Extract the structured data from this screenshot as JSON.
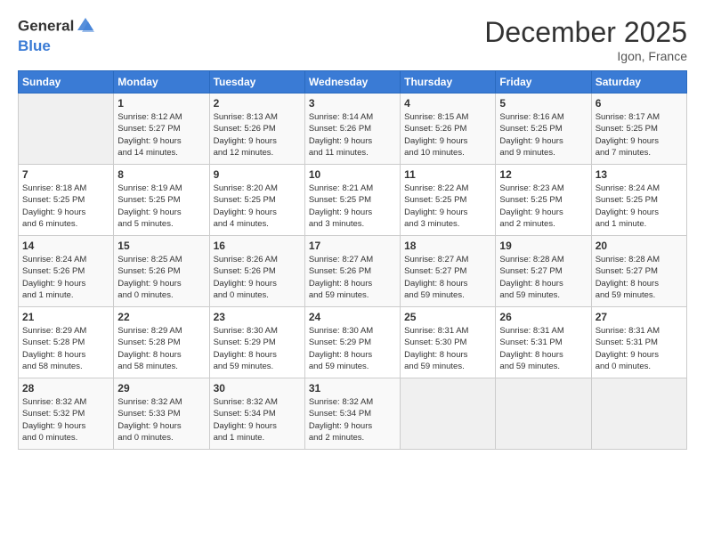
{
  "header": {
    "logo_general": "General",
    "logo_blue": "Blue",
    "title": "December 2025",
    "location": "Igon, France"
  },
  "days_of_week": [
    "Sunday",
    "Monday",
    "Tuesday",
    "Wednesday",
    "Thursday",
    "Friday",
    "Saturday"
  ],
  "weeks": [
    [
      {
        "day": "",
        "info": ""
      },
      {
        "day": "1",
        "info": "Sunrise: 8:12 AM\nSunset: 5:27 PM\nDaylight: 9 hours\nand 14 minutes."
      },
      {
        "day": "2",
        "info": "Sunrise: 8:13 AM\nSunset: 5:26 PM\nDaylight: 9 hours\nand 12 minutes."
      },
      {
        "day": "3",
        "info": "Sunrise: 8:14 AM\nSunset: 5:26 PM\nDaylight: 9 hours\nand 11 minutes."
      },
      {
        "day": "4",
        "info": "Sunrise: 8:15 AM\nSunset: 5:26 PM\nDaylight: 9 hours\nand 10 minutes."
      },
      {
        "day": "5",
        "info": "Sunrise: 8:16 AM\nSunset: 5:25 PM\nDaylight: 9 hours\nand 9 minutes."
      },
      {
        "day": "6",
        "info": "Sunrise: 8:17 AM\nSunset: 5:25 PM\nDaylight: 9 hours\nand 7 minutes."
      }
    ],
    [
      {
        "day": "7",
        "info": "Sunrise: 8:18 AM\nSunset: 5:25 PM\nDaylight: 9 hours\nand 6 minutes."
      },
      {
        "day": "8",
        "info": "Sunrise: 8:19 AM\nSunset: 5:25 PM\nDaylight: 9 hours\nand 5 minutes."
      },
      {
        "day": "9",
        "info": "Sunrise: 8:20 AM\nSunset: 5:25 PM\nDaylight: 9 hours\nand 4 minutes."
      },
      {
        "day": "10",
        "info": "Sunrise: 8:21 AM\nSunset: 5:25 PM\nDaylight: 9 hours\nand 3 minutes."
      },
      {
        "day": "11",
        "info": "Sunrise: 8:22 AM\nSunset: 5:25 PM\nDaylight: 9 hours\nand 3 minutes."
      },
      {
        "day": "12",
        "info": "Sunrise: 8:23 AM\nSunset: 5:25 PM\nDaylight: 9 hours\nand 2 minutes."
      },
      {
        "day": "13",
        "info": "Sunrise: 8:24 AM\nSunset: 5:25 PM\nDaylight: 9 hours\nand 1 minute."
      }
    ],
    [
      {
        "day": "14",
        "info": "Sunrise: 8:24 AM\nSunset: 5:26 PM\nDaylight: 9 hours\nand 1 minute."
      },
      {
        "day": "15",
        "info": "Sunrise: 8:25 AM\nSunset: 5:26 PM\nDaylight: 9 hours\nand 0 minutes."
      },
      {
        "day": "16",
        "info": "Sunrise: 8:26 AM\nSunset: 5:26 PM\nDaylight: 9 hours\nand 0 minutes."
      },
      {
        "day": "17",
        "info": "Sunrise: 8:27 AM\nSunset: 5:26 PM\nDaylight: 8 hours\nand 59 minutes."
      },
      {
        "day": "18",
        "info": "Sunrise: 8:27 AM\nSunset: 5:27 PM\nDaylight: 8 hours\nand 59 minutes."
      },
      {
        "day": "19",
        "info": "Sunrise: 8:28 AM\nSunset: 5:27 PM\nDaylight: 8 hours\nand 59 minutes."
      },
      {
        "day": "20",
        "info": "Sunrise: 8:28 AM\nSunset: 5:27 PM\nDaylight: 8 hours\nand 59 minutes."
      }
    ],
    [
      {
        "day": "21",
        "info": "Sunrise: 8:29 AM\nSunset: 5:28 PM\nDaylight: 8 hours\nand 58 minutes."
      },
      {
        "day": "22",
        "info": "Sunrise: 8:29 AM\nSunset: 5:28 PM\nDaylight: 8 hours\nand 58 minutes."
      },
      {
        "day": "23",
        "info": "Sunrise: 8:30 AM\nSunset: 5:29 PM\nDaylight: 8 hours\nand 59 minutes."
      },
      {
        "day": "24",
        "info": "Sunrise: 8:30 AM\nSunset: 5:29 PM\nDaylight: 8 hours\nand 59 minutes."
      },
      {
        "day": "25",
        "info": "Sunrise: 8:31 AM\nSunset: 5:30 PM\nDaylight: 8 hours\nand 59 minutes."
      },
      {
        "day": "26",
        "info": "Sunrise: 8:31 AM\nSunset: 5:31 PM\nDaylight: 8 hours\nand 59 minutes."
      },
      {
        "day": "27",
        "info": "Sunrise: 8:31 AM\nSunset: 5:31 PM\nDaylight: 9 hours\nand 0 minutes."
      }
    ],
    [
      {
        "day": "28",
        "info": "Sunrise: 8:32 AM\nSunset: 5:32 PM\nDaylight: 9 hours\nand 0 minutes."
      },
      {
        "day": "29",
        "info": "Sunrise: 8:32 AM\nSunset: 5:33 PM\nDaylight: 9 hours\nand 0 minutes."
      },
      {
        "day": "30",
        "info": "Sunrise: 8:32 AM\nSunset: 5:34 PM\nDaylight: 9 hours\nand 1 minute."
      },
      {
        "day": "31",
        "info": "Sunrise: 8:32 AM\nSunset: 5:34 PM\nDaylight: 9 hours\nand 2 minutes."
      },
      {
        "day": "",
        "info": ""
      },
      {
        "day": "",
        "info": ""
      },
      {
        "day": "",
        "info": ""
      }
    ]
  ]
}
